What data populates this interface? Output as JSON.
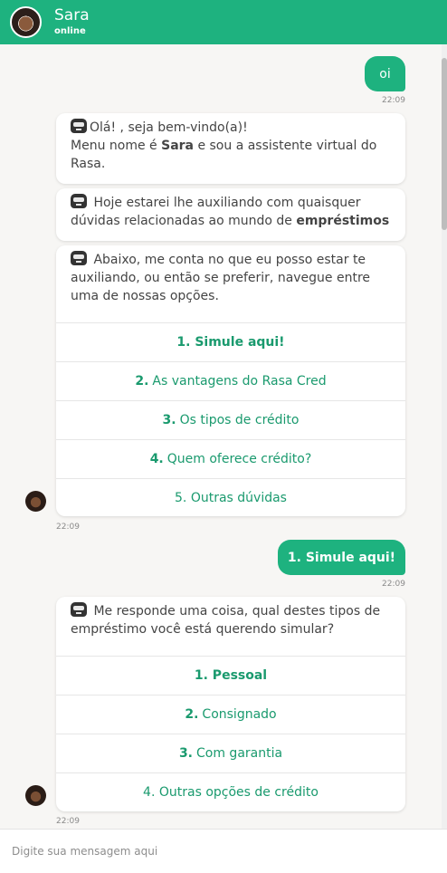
{
  "header": {
    "name": "Sara",
    "status": "online"
  },
  "messages": {
    "user_1": {
      "text": "oi",
      "time": "22:09"
    },
    "bot_1": {
      "part1_a": "Olá! , seja bem-vindo(a)!",
      "part1_b": "Menu nome é",
      "part1_name": "Sara",
      "part1_c": "e sou a assistente virtual do Rasa.",
      "part2_a": "Hoje estarei lhe auxiliando com quaisquer dúvidas relacionadas ao mundo de",
      "part2_bold": "empréstimos",
      "part3": "Abaixo, me conta no que eu posso estar te auxiliando, ou então se preferir, navegue entre uma de nossas opções.",
      "options": [
        {
          "label": "1. Simule aqui!"
        },
        {
          "num": "2.",
          "label": "As vantagens do Rasa Cred"
        },
        {
          "num": "3.",
          "label": "Os tipos de crédito"
        },
        {
          "num": "4.",
          "label": "Quem oferece crédito?"
        },
        {
          "label": "5. Outras dúvidas"
        }
      ],
      "time": "22:09"
    },
    "user_2": {
      "text": "1. Simule aqui!",
      "time": "22:09"
    },
    "bot_2": {
      "text": "Me responde uma coisa, qual destes tipos de empréstimo você está querendo simular?",
      "options": [
        {
          "label": "1. Pessoal"
        },
        {
          "num": "2.",
          "label": "Consignado"
        },
        {
          "num": "3.",
          "label": "Com garantia"
        },
        {
          "label": "4. Outras opções de crédito"
        }
      ],
      "time": "22:09"
    }
  },
  "input": {
    "placeholder": "Digite sua mensagem aqui"
  },
  "colors": {
    "accent": "#1eb27f",
    "option_text": "#1a9a6e",
    "background": "#f7f6f4"
  }
}
